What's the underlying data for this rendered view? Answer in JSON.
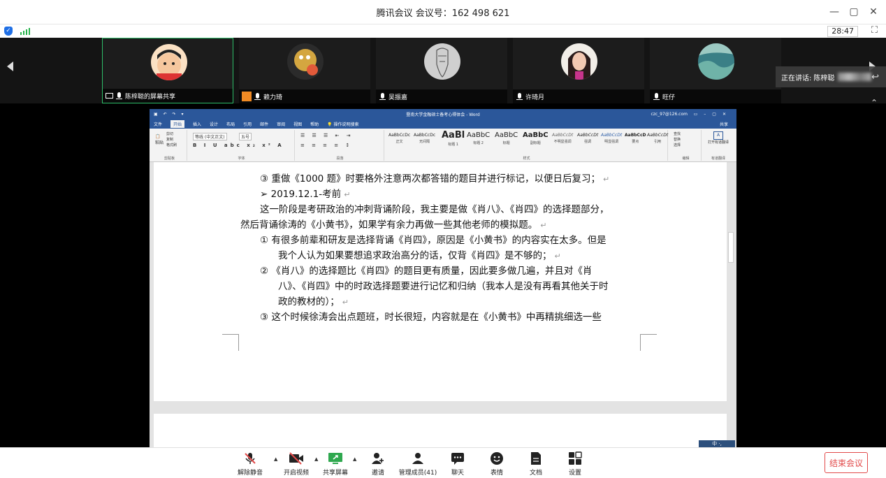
{
  "window": {
    "title": "腾讯会议 会议号：162 498 621",
    "controls": [
      "—",
      "▢",
      "✕"
    ]
  },
  "status": {
    "timer": "28:47",
    "colors": {
      "shield": "#1f6fe5",
      "signal": "#25b24a"
    }
  },
  "participants": [
    {
      "name": "陈梓聪的屏幕共享",
      "active": true,
      "avatar_color": "#f2c49b"
    },
    {
      "name": "赖力琦",
      "active": false,
      "avatar_color": "#d4a640"
    },
    {
      "name": "吴振嘉",
      "active": false,
      "avatar_color": "#cfcfcf"
    },
    {
      "name": "许琦月",
      "active": false,
      "avatar_color": "#f3b8a0"
    },
    {
      "name": "旺仔",
      "active": false,
      "avatar_color": "#3a7f86"
    }
  ],
  "speaking": {
    "label": "正在讲话: 陈梓聪"
  },
  "word": {
    "doc_title": "暨南大学金融硕士备考心得体会 - Word",
    "account": "czc_97@126.com",
    "menu": [
      "文件",
      "开始",
      "插入",
      "设计",
      "布局",
      "引用",
      "邮件",
      "审阅",
      "视图",
      "帮助",
      "操作说明搜索"
    ],
    "selected_menu": "开始",
    "share_label": "共享",
    "ribbon_groups": [
      "剪贴板",
      "字体",
      "段落",
      "样式",
      "编辑",
      "有道翻译"
    ],
    "clipboard": {
      "paste": "粘贴",
      "cut": "剪切",
      "copy": "复制",
      "format_painter": "格式刷"
    },
    "font_name": "等线 (中文正文)",
    "font_size": "五号",
    "styles": [
      {
        "sample": "AaBbCcDc",
        "name": "正文"
      },
      {
        "sample": "AaBbCcDc",
        "name": "无间隔"
      },
      {
        "sample": "AaBl",
        "name": "标题 1"
      },
      {
        "sample": "AaBbC",
        "name": "标题 2"
      },
      {
        "sample": "AaBbC",
        "name": "标题"
      },
      {
        "sample": "AaBbC",
        "name": "副标题"
      },
      {
        "sample": "AaBbCcDt",
        "name": "不明显强调"
      },
      {
        "sample": "AaBbCcDt",
        "name": "强调"
      },
      {
        "sample": "AaBbCcDt",
        "name": "明显强调"
      },
      {
        "sample": "AaBbCcD",
        "name": "要点"
      },
      {
        "sample": "AaBbCcDt",
        "name": "引用"
      }
    ],
    "editing": {
      "find": "查找",
      "replace": "替换",
      "select": "选择"
    },
    "youdao": "打开有道翻译",
    "lines": [
      "③  重做《1000 题》时要格外注意两次都答错的题目并进行标记，以便日后复习；",
      "➢   2019.12.1-考前",
      "这一阶段是考研政治的冲刺背诵阶段，我主要是做《肖八》、《肖四》的选择题部分，",
      "然后背诵徐涛的《小黄书》，如果学有余力再做一些其他老师的模拟题。",
      "①  有很多前辈和研友是选择背诵《肖四》，原因是《小黄书》的内容实在太多。但是",
      "我个人认为如果要想追求政治高分的话，仅背《肖四》是不够的；",
      "②  《肖八》的选择题比《肖四》的题目更有质量，因此要多做几遍，并且对《肖",
      "八》、《肖四》中的时政选择题要进行记忆和归纳（我本人是没有再看其他关于时",
      "政的教材的）；",
      "③  这个时候徐涛会出点题班，时长很短，内容就是在《小黄书》中再精挑细选一些"
    ],
    "ime": "中 ·,"
  },
  "toolbar": {
    "mute": "解除静音",
    "video": "开启视频",
    "share": "共享屏幕",
    "invite": "邀请",
    "members": "管理成员(41)",
    "chat": "聊天",
    "emoji": "表情",
    "docs": "文档",
    "settings": "设置",
    "end": "结束会议",
    "colors": {
      "share": "#2fa84f",
      "end": "#e24a4a"
    }
  }
}
